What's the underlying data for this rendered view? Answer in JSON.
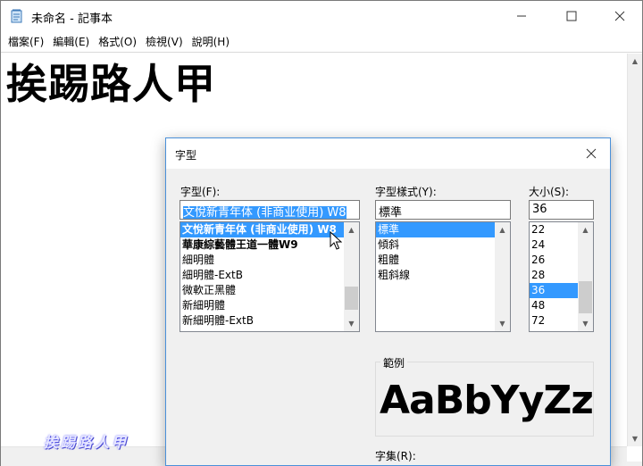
{
  "window": {
    "title": "未命名 - 記事本",
    "minimize_glyph": "—",
    "maximize_glyph": "☐",
    "close_glyph": "✕"
  },
  "menu": [
    {
      "label": "檔案(F)"
    },
    {
      "label": "編輯(E)"
    },
    {
      "label": "格式(O)"
    },
    {
      "label": "檢視(V)"
    },
    {
      "label": "說明(H)"
    }
  ],
  "editor": {
    "content": "挨踢路人甲"
  },
  "watermark": "挨踢路人甲",
  "dialog": {
    "title": "字型",
    "close_glyph": "✕",
    "font": {
      "label": "字型(F):",
      "value": "文悅新青年体 (非商业使用) W8",
      "items": [
        {
          "label": "文悅新青年体 (非商业使用) W8",
          "selected": true,
          "bold": true
        },
        {
          "label": "華康綜藝體王道一體W9",
          "selected": false,
          "bold": true
        },
        {
          "label": "細明體",
          "selected": false,
          "bold": false
        },
        {
          "label": "細明體-ExtB",
          "selected": false,
          "bold": false
        },
        {
          "label": "微軟正黑體",
          "selected": false,
          "bold": false
        },
        {
          "label": "新細明體",
          "selected": false,
          "bold": false
        },
        {
          "label": "新細明體-ExtB",
          "selected": false,
          "bold": false
        }
      ]
    },
    "style": {
      "label": "字型樣式(Y):",
      "value": "標準",
      "items": [
        {
          "label": "標準",
          "selected": true
        },
        {
          "label": "傾斜",
          "selected": false
        },
        {
          "label": "粗體",
          "selected": false
        },
        {
          "label": "粗斜線",
          "selected": false
        }
      ]
    },
    "size": {
      "label": "大小(S):",
      "value": "36",
      "items": [
        {
          "label": "22",
          "selected": false
        },
        {
          "label": "24",
          "selected": false
        },
        {
          "label": "26",
          "selected": false
        },
        {
          "label": "28",
          "selected": false
        },
        {
          "label": "36",
          "selected": true
        },
        {
          "label": "48",
          "selected": false
        },
        {
          "label": "72",
          "selected": false
        }
      ]
    },
    "sample": {
      "label": "範例",
      "text": "AaBbYyZz"
    },
    "charset": {
      "label": "字集(R):"
    }
  }
}
